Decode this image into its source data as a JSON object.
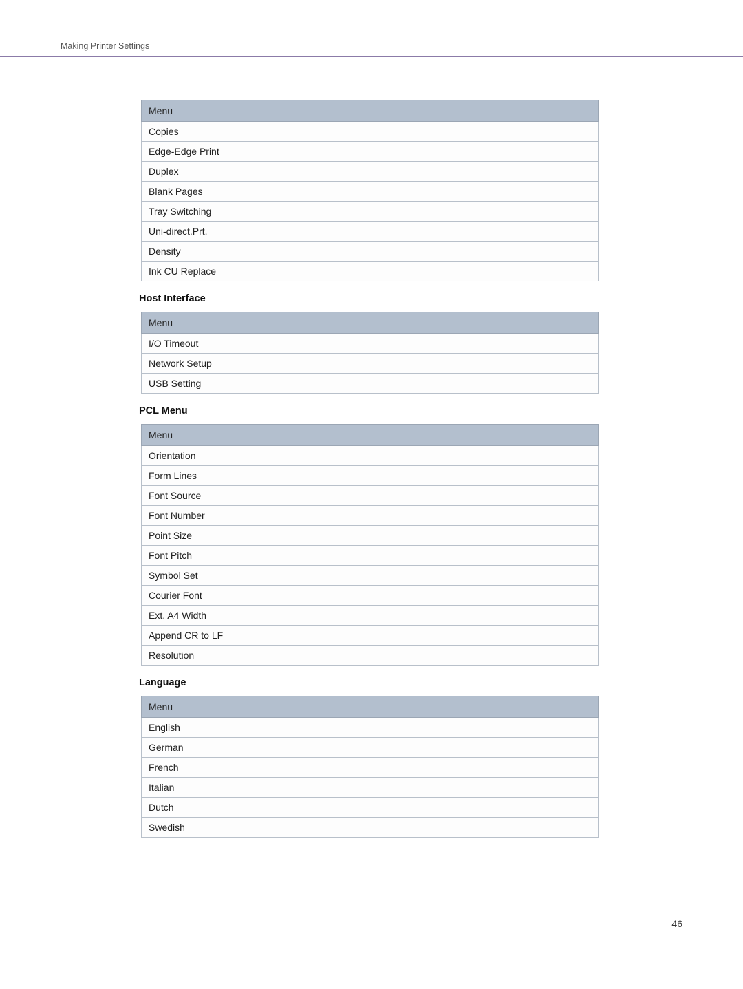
{
  "header": {
    "title": "Making Printer Settings"
  },
  "sections": [
    {
      "heading": null,
      "table": {
        "header": "Menu",
        "rows": [
          "Copies",
          "Edge-Edge Print",
          "Duplex",
          "Blank Pages",
          "Tray Switching",
          "Uni-direct.Prt.",
          "Density",
          "Ink CU Replace"
        ]
      }
    },
    {
      "heading": "Host Interface",
      "table": {
        "header": "Menu",
        "rows": [
          "I/O Timeout",
          "Network Setup",
          "USB Setting"
        ]
      }
    },
    {
      "heading": "PCL Menu",
      "table": {
        "header": "Menu",
        "rows": [
          "Orientation",
          "Form Lines",
          "Font Source",
          "Font Number",
          "Point Size",
          "Font Pitch",
          "Symbol Set",
          "Courier Font",
          "Ext. A4 Width",
          "Append CR to LF",
          "Resolution"
        ]
      }
    },
    {
      "heading": "Language",
      "table": {
        "header": "Menu",
        "rows": [
          "English",
          "German",
          "French",
          "Italian",
          "Dutch",
          "Swedish"
        ]
      }
    }
  ],
  "footer": {
    "page_number": "46"
  }
}
